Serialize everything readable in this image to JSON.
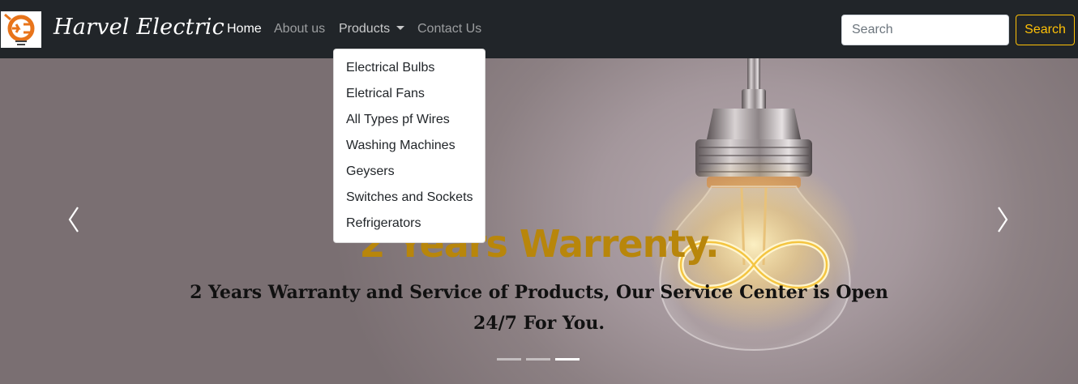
{
  "colors": {
    "navbar_bg": "#212529",
    "accent_warning": "#ffc107",
    "caption_title": "#b8860b",
    "logo_orange": "#e8741a"
  },
  "brand": {
    "logo_icon": "bulb-logo-icon",
    "name": "Harvel Electric"
  },
  "nav": {
    "home": "Home",
    "about": "About us",
    "products": "Products",
    "contact": "Contact Us"
  },
  "search": {
    "placeholder": "Search",
    "value": "",
    "button_label": "Search"
  },
  "products_dropdown": {
    "items": [
      "Electrical Bulbs",
      "Eletrical Fans",
      "All Types pf Wires",
      "Washing Machines",
      "Geysers",
      "Switches and Sockets",
      "Refrigerators"
    ]
  },
  "carousel": {
    "title": "2 Years Warrenty.",
    "text": "2 Years Warranty and Service of Products, Our Service Center is Open 24/7 For You.",
    "prev_icon": "chevron-left-icon",
    "next_icon": "chevron-right-icon",
    "slide_count": 3,
    "active_slide": 3
  }
}
